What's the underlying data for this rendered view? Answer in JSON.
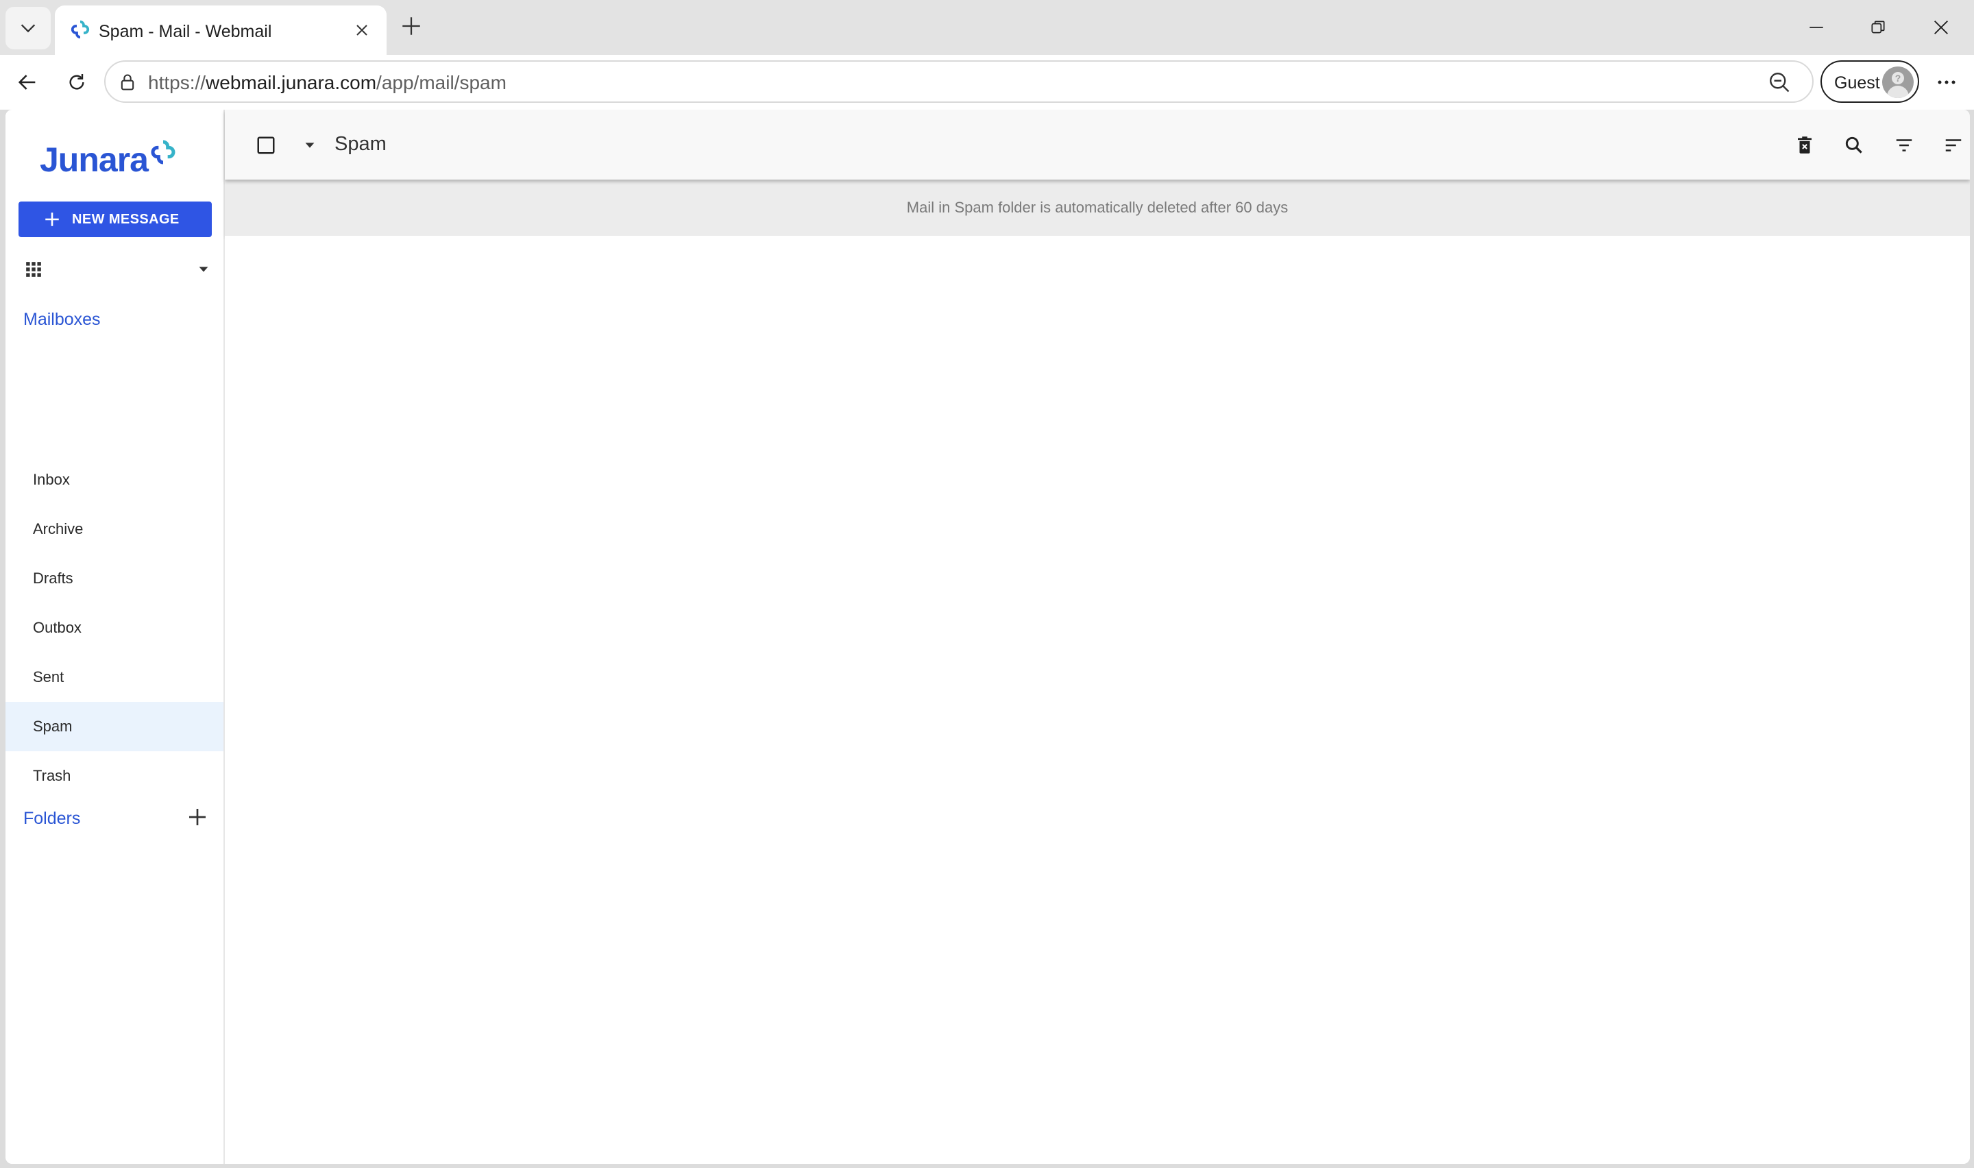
{
  "browser": {
    "tab_title": "Spam - Mail - Webmail",
    "url_scheme": "https://",
    "url_host": "webmail.junara.com",
    "url_path": "/app/mail/spam",
    "profile_label": "Guest"
  },
  "app": {
    "logo_text": "Junara",
    "brand_color": "#2a55d4",
    "new_message_label": "NEW MESSAGE",
    "mailboxes_heading": "Mailboxes",
    "mailboxes": [
      {
        "label": "Inbox",
        "active": false
      },
      {
        "label": "Archive",
        "active": false
      },
      {
        "label": "Drafts",
        "active": false
      },
      {
        "label": "Outbox",
        "active": false
      },
      {
        "label": "Sent",
        "active": false
      },
      {
        "label": "Spam",
        "active": true
      },
      {
        "label": "Trash",
        "active": false
      }
    ],
    "folders_heading": "Folders"
  },
  "main": {
    "folder_title": "Spam",
    "notice": "Mail in Spam folder is automatically deleted after 60 days",
    "messages": []
  },
  "icons": {
    "tab_list": "chevron-down-icon",
    "new_tab": "plus-icon",
    "back": "arrow-left-icon",
    "reload": "reload-icon",
    "lock": "lock-icon",
    "zoom": "zoom-out-icon",
    "more": "ellipsis-icon",
    "empty_spam": "delete-forever-icon",
    "search": "search-icon",
    "filter": "filter-icon",
    "sort": "sort-icon"
  }
}
